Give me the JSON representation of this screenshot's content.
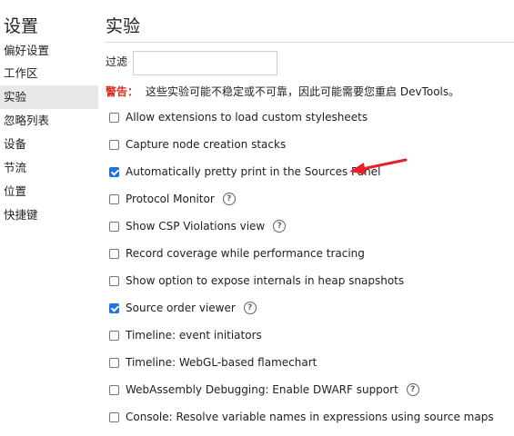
{
  "sidebar": {
    "title": "设置",
    "items": [
      {
        "label": "偏好设置"
      },
      {
        "label": "工作区"
      },
      {
        "label": "实验"
      },
      {
        "label": "忽略列表"
      },
      {
        "label": "设备"
      },
      {
        "label": "节流"
      },
      {
        "label": "位置"
      },
      {
        "label": "快捷键"
      }
    ],
    "active_index": 2
  },
  "main": {
    "title": "实验",
    "filter": {
      "label": "过滤",
      "value": "",
      "placeholder": ""
    },
    "warning": {
      "label": "警告：",
      "text": "这些实验可能不稳定或不可靠，因此可能需要您重启 DevTools。"
    },
    "experiments": [
      {
        "label": "Allow extensions to load custom stylesheets",
        "checked": false,
        "has_help": false
      },
      {
        "label": "Capture node creation stacks",
        "checked": false,
        "has_help": false
      },
      {
        "label": "Automatically pretty print in the Sources Panel",
        "checked": true,
        "has_help": false
      },
      {
        "label": "Protocol Monitor",
        "checked": false,
        "has_help": true
      },
      {
        "label": "Show CSP Violations view",
        "checked": false,
        "has_help": true
      },
      {
        "label": "Record coverage while performance tracing",
        "checked": false,
        "has_help": false
      },
      {
        "label": "Show option to expose internals in heap snapshots",
        "checked": false,
        "has_help": false
      },
      {
        "label": "Source order viewer",
        "checked": true,
        "has_help": true
      },
      {
        "label": "Timeline: event initiators",
        "checked": false,
        "has_help": false
      },
      {
        "label": "Timeline: WebGL-based flamechart",
        "checked": false,
        "has_help": false
      },
      {
        "label": "WebAssembly Debugging: Enable DWARF support",
        "checked": false,
        "has_help": true
      },
      {
        "label": "Console: Resolve variable names in expressions using source maps",
        "checked": false,
        "has_help": false
      }
    ]
  },
  "colors": {
    "accent": "#1a73e8",
    "warning": "#d93025",
    "annotation_arrow": "#e8202a",
    "active_nav_bg": "#e8e8e8"
  },
  "icons": {
    "help": "help-circle-icon",
    "annotation": "red-arrow-annotation"
  }
}
